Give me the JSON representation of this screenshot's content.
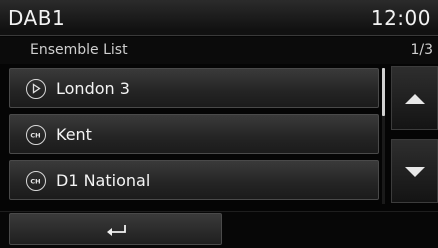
{
  "header": {
    "title": "DAB1",
    "clock": "12:00"
  },
  "subheader": {
    "title": "Ensemble List",
    "page_indicator": "1/3"
  },
  "list": {
    "items": [
      {
        "label": "London 3",
        "icon": "play-icon"
      },
      {
        "label": "Kent",
        "icon": "channel-icon"
      },
      {
        "label": "D1 National",
        "icon": "channel-icon"
      }
    ]
  },
  "icons": {
    "channel_text": "CH"
  },
  "scroll": {
    "position_fraction": 0.0,
    "visible_fraction": 0.33
  },
  "controls": {
    "up": "scroll-up",
    "down": "scroll-down",
    "back": "back-arrow-icon"
  },
  "colors": {
    "background": "#050505",
    "text": "#f4f4f4",
    "item_gradient_top": "#3a3a3a",
    "item_gradient_bottom": "#1b1b1b"
  }
}
